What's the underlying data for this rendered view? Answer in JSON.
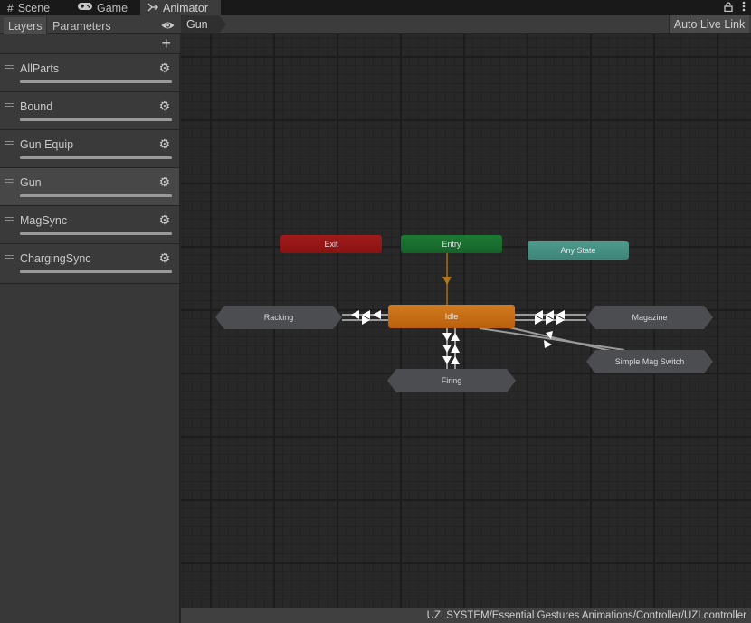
{
  "tabs": [
    {
      "label": "Scene",
      "icon": "grid-icon",
      "glyph": "#",
      "active": false
    },
    {
      "label": "Game",
      "icon": "gamepad-icon",
      "glyph": "🎮",
      "active": false
    },
    {
      "label": "Animator",
      "icon": "animator-icon",
      "glyph": "⤚",
      "active": true
    }
  ],
  "window_controls": {
    "lock_glyph": "🔓",
    "menu_glyph": "⋮"
  },
  "toolbar": {
    "layers_label": "Layers",
    "parameters_label": "Parameters",
    "eye_glyph": "👁",
    "breadcrumb": "Gun",
    "auto_live_link_label": "Auto Live Link"
  },
  "layers_panel": {
    "add_glyph": "+",
    "gear_glyph": "⚙",
    "layers": [
      {
        "name": "AllParts",
        "selected": false,
        "weight": 1.0
      },
      {
        "name": "Bound",
        "selected": false,
        "weight": 1.0
      },
      {
        "name": "Gun Equip",
        "selected": false,
        "weight": 1.0
      },
      {
        "name": "Gun",
        "selected": true,
        "weight": 1.0
      },
      {
        "name": "MagSync",
        "selected": false,
        "weight": 1.0
      },
      {
        "name": "ChargingSync",
        "selected": false,
        "weight": 1.0
      }
    ]
  },
  "graph": {
    "states": {
      "exit": "Exit",
      "entry": "Entry",
      "any_state": "Any State",
      "idle": "Idle",
      "racking": "Racking",
      "magazine": "Magazine",
      "firing": "Firing",
      "simple_mag_switch": "Simple Mag Switch"
    },
    "colors": {
      "exit": "#a11b1b",
      "entry": "#1d7a32",
      "any_state": "#4d9a8c",
      "default_state": "#d37b1e",
      "state": "#4b4d50",
      "default_transition": "#9a6a14",
      "transition": "#9a9a9a"
    },
    "transitions": [
      {
        "from": "Entry",
        "to": "Idle",
        "default": true
      },
      {
        "from": "Idle",
        "to": "Racking",
        "count": 3
      },
      {
        "from": "Racking",
        "to": "Idle",
        "count": 1
      },
      {
        "from": "Idle",
        "to": "Magazine",
        "count": 3
      },
      {
        "from": "Magazine",
        "to": "Idle",
        "count": 3
      },
      {
        "from": "Idle",
        "to": "Firing",
        "count": 3
      },
      {
        "from": "Firing",
        "to": "Idle",
        "count": 3
      },
      {
        "from": "Idle",
        "to": "Simple Mag Switch",
        "count": 1
      },
      {
        "from": "Simple Mag Switch",
        "to": "Idle",
        "count": 1
      }
    ]
  },
  "status_bar": {
    "path": "UZI SYSTEM/Essential Gestures Animations/Controller/UZI.controller"
  }
}
